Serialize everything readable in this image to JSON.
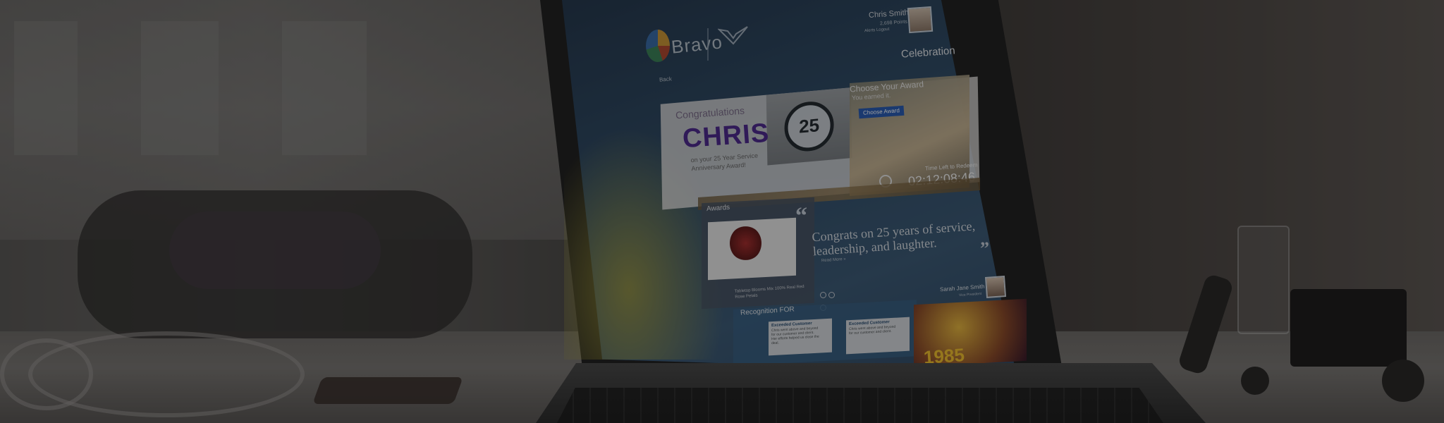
{
  "header": {
    "logo_text": "Bravo",
    "user_name": "Chris Smith",
    "user_points": "2,698 Points",
    "user_links": "Alerts   Logout",
    "page_heading": "Celebration",
    "back_link": "Back"
  },
  "hero": {
    "congrats": "Congratulations",
    "name": "CHRIS",
    "subtitle": "on your 25 Year Service Anniversary Award!",
    "badge": "25"
  },
  "award": {
    "title": "Choose Your Award",
    "subtitle": "You earned it.",
    "button_label": "Choose Award",
    "time_label": "Time Left to Redeem",
    "time_value": "02:12:08:46"
  },
  "awards_panel": {
    "title": "Awards",
    "caption": "Tabletop Blooms Mix 100% Real Red Rose Petals"
  },
  "quote": {
    "open_mark": "“",
    "text": "Congrats on 25 years of service, leadership, and laughter.",
    "close_mark": "”",
    "read_more": "Read More »",
    "author": "Sarah Jane Smith",
    "author_title": "Vice President"
  },
  "recognition": {
    "title": "Recognition FOR",
    "cards": [
      {
        "title": "Exceeded Customer",
        "text": "Chris went above and beyond for our customer and client. Her efforts helped us close the deal."
      },
      {
        "title": "Exceeded Customer",
        "text": "Chris went above and beyond for our customer and client."
      }
    ],
    "photo_number": "1985"
  }
}
